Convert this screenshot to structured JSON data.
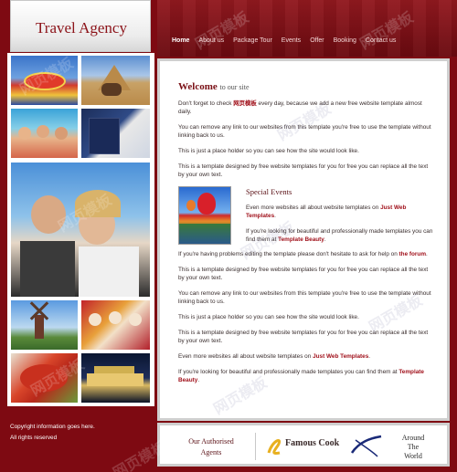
{
  "site": {
    "logo_text": "Travel Agency"
  },
  "nav": {
    "items": [
      {
        "label": "Home",
        "active": true
      },
      {
        "label": "About us",
        "active": false
      },
      {
        "label": "Package Tour",
        "active": false
      },
      {
        "label": "Events",
        "active": false
      },
      {
        "label": "Offer",
        "active": false
      },
      {
        "label": "Booking",
        "active": false
      },
      {
        "label": "Contact us",
        "active": false
      }
    ]
  },
  "welcome": {
    "title_big": "Welcome",
    "title_small": "to our site",
    "p1_pre": "Don't forget to check ",
    "p1_link": "网页模板",
    "p1_post": " every day, because we add a new free website template almost daily.",
    "p2": "You can remove any link to our websites from this template you're free to use the template without linking back to us.",
    "p3": "This is just a place holder so you can see how the site would look like.",
    "p4": "This is a template designed by free website templates for you for free you can replace all the text by your own text."
  },
  "events": {
    "title": "Special Events",
    "p1_pre": "Even more websites all about website templates on ",
    "p1_link": "Just Web Templates",
    "p1_post": ".",
    "p2_pre": "If you're looking for beautiful and professionally made templates you can find them at ",
    "p2_link": "Template Beauty",
    "p2_post": "."
  },
  "body": {
    "p5_pre": "If you're having problems editing the template please don't hesitate to ask for help on ",
    "p5_link": "the forum",
    "p5_post": ".",
    "p6": "This is a template designed by free website templates for you for free you can replace all the text by your own text.",
    "p7": "You can remove any link to our websites from this template you're free to use the template without linking back to us.",
    "p8": "This is just a place holder so you can see how the site would look like.",
    "p9": "This is a template designed by free website templates for you for free you can replace all the text by your own text.",
    "p10_pre": "Even more websites all about website templates on ",
    "p10_link": "Just Web Templates",
    "p10_post": ".",
    "p11_pre": "If you're looking for beautiful and professionally made templates you can find them at ",
    "p11_link": "Template Beauty",
    "p11_post": "."
  },
  "agents": {
    "title_line1": "Our Authorised",
    "title_line2": "Agents",
    "cook_label": "Famous Cook",
    "atw_line1": "Around",
    "atw_line2": "The",
    "atw_line3": "World"
  },
  "footer": {
    "line1": "Copyright information goes here.",
    "line2": "All rights reserved"
  },
  "watermark": "网页模板",
  "colors": {
    "brand_red": "#7e0a12",
    "link_red": "#a0101a"
  }
}
